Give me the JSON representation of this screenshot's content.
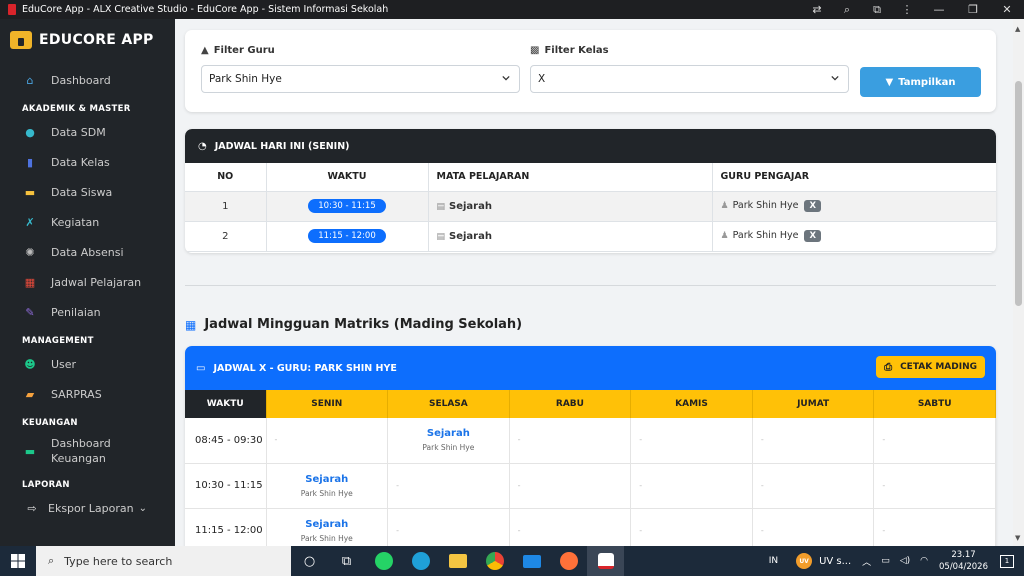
{
  "window": {
    "title": "EduCore App - ALX Creative Studio - EduCore App - Sistem Informasi Sekolah"
  },
  "sidebar": {
    "brand": "EDUCORE APP",
    "items": [
      {
        "label": "Dashboard",
        "icon": "home-icon"
      },
      {
        "section": "AKADEMIK & MASTER"
      },
      {
        "label": "Data SDM",
        "icon": "user-tie-icon"
      },
      {
        "label": "Data Kelas",
        "icon": "door-icon"
      },
      {
        "label": "Data Siswa",
        "icon": "id-card-icon"
      },
      {
        "label": "Kegiatan",
        "icon": "running-icon"
      },
      {
        "label": "Data Absensi",
        "icon": "fingerprint-icon"
      },
      {
        "label": "Jadwal Pelajaran",
        "icon": "calendar-icon"
      },
      {
        "label": "Penilaian",
        "icon": "pen-icon"
      },
      {
        "section": "MANAGEMENT"
      },
      {
        "label": "User",
        "icon": "users-icon"
      },
      {
        "label": "SARPRAS",
        "icon": "boxes-icon"
      },
      {
        "section": "KEUANGAN"
      },
      {
        "label": "Dashboard",
        "label2": "Keuangan",
        "icon": "wallet-icon"
      },
      {
        "section": "LAPORAN"
      },
      {
        "label": "Ekspor Laporan",
        "icon": "file-export-icon"
      }
    ]
  },
  "filter": {
    "guru_label": "Filter Guru",
    "guru_value": "Park Shin Hye",
    "kelas_label": "Filter Kelas",
    "kelas_value": "X",
    "button_label": "Tampilkan"
  },
  "today": {
    "title": "JADWAL HARI INI (SENIN)",
    "columns": [
      "NO",
      "WAKTU",
      "MATA PELAJARAN",
      "GURU PENGAJAR"
    ],
    "rows": [
      {
        "no": "1",
        "waktu": "10:30 - 11:15",
        "mapel": "Sejarah",
        "guru": "Park Shin Hye",
        "kelas": "X"
      },
      {
        "no": "2",
        "waktu": "11:15 - 12:00",
        "mapel": "Sejarah",
        "guru": "Park Shin Hye",
        "kelas": "X"
      }
    ]
  },
  "weekly": {
    "section_title": "Jadwal Mingguan Matriks (Mading Sekolah)",
    "header_title": "JADWAL X - GURU: PARK SHIN HYE",
    "print_label": "CETAK MADING",
    "columns": [
      "WAKTU",
      "SENIN",
      "SELASA",
      "RABU",
      "KAMIS",
      "JUMAT",
      "SABTU"
    ],
    "empty": "-",
    "rows": [
      {
        "waktu": "08:45 - 09:30",
        "slots": [
          "",
          "Sejarah|Park Shin Hye",
          "",
          "",
          "",
          ""
        ]
      },
      {
        "waktu": "10:30 - 11:15",
        "slots": [
          "Sejarah|Park Shin Hye",
          "",
          "",
          "",
          "",
          ""
        ]
      },
      {
        "waktu": "11:15 - 12:00",
        "slots": [
          "Sejarah|Park Shin Hye",
          "",
          "",
          "",
          "",
          ""
        ]
      }
    ]
  },
  "taskbar": {
    "search_placeholder": "Type here to search",
    "lang": "IN",
    "weather": "UV s...",
    "weather_badge": "UV",
    "time": "23.17",
    "date": "05/04/2026",
    "notif_count": "1"
  },
  "colors": {
    "sidebar": "#212529",
    "primary": "#0d6efd",
    "accent_yellow": "#ffc107",
    "button_blue": "#3a9ee0"
  }
}
